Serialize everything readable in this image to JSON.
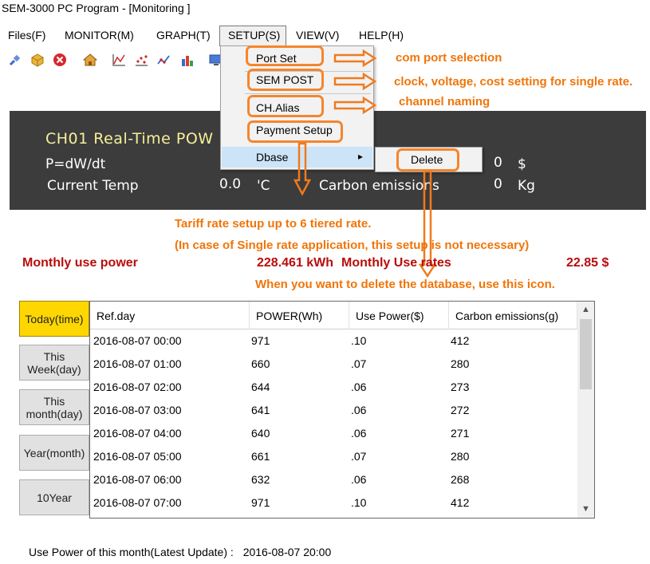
{
  "window": {
    "title": "SEM-3000 PC Program - [Monitoring ]"
  },
  "menu": {
    "items": [
      "Files(F)",
      "MONITOR(M)",
      "GRAPH(T)",
      "SETUP(S)",
      "VIEW(V)",
      "HELP(H)"
    ],
    "active": "SETUP(S)"
  },
  "toolbar": {
    "icons": [
      "plug-icon",
      "box-icon",
      "stop-icon",
      "home-icon",
      "chart-icon",
      "scatter-icon",
      "line-icon",
      "bar-chart-icon",
      "monitor-icon"
    ]
  },
  "setup_menu": {
    "items": [
      "Port Set",
      "SEM POST",
      "CH.Alias",
      "Payment Setup",
      "Dbase"
    ],
    "submenu_arrow": "▸",
    "submenu_items": [
      "Delete"
    ]
  },
  "realtime": {
    "title": "CH01   Real-Time POW",
    "formula": "P=dW/dt",
    "temp_label": "Current Temp",
    "temp_value": "0.0",
    "temp_unit": "'C",
    "carbon_label": "Carbon emissions",
    "rate_value": "0",
    "rate_unit": "$",
    "carbon_value": "0",
    "carbon_unit": "Kg"
  },
  "annotations": {
    "port_set": "com port selection",
    "sem_post": "clock, voltage, cost setting for single rate.",
    "alias": "channel naming",
    "payment_1": "Tariff rate setup up to 6 tiered rate.",
    "payment_2": "(In case of Single rate application, this setup is not necessary)",
    "delete": "When you want to delete the database, use this icon."
  },
  "monthly": {
    "use_power_label": "Monthly use power",
    "use_power_value": "228.461 kWh",
    "use_rates_label": "Monthly Use rates",
    "use_rates_value": "22.85 $"
  },
  "period_buttons": [
    "Today(time)",
    "This Week(day)",
    "This month(day)",
    "Year(month)",
    "10Year"
  ],
  "table": {
    "columns": [
      "Ref.day",
      "POWER(Wh)",
      "Use Power($)",
      "Carbon emissions(g)"
    ],
    "rows": [
      [
        "2016-08-07 00:00",
        "971",
        ".10",
        "412"
      ],
      [
        "2016-08-07 01:00",
        "660",
        ".07",
        "280"
      ],
      [
        "2016-08-07 02:00",
        "644",
        ".06",
        "273"
      ],
      [
        "2016-08-07 03:00",
        "641",
        ".06",
        "272"
      ],
      [
        "2016-08-07 04:00",
        "640",
        ".06",
        "271"
      ],
      [
        "2016-08-07 05:00",
        "661",
        ".07",
        "280"
      ],
      [
        "2016-08-07 06:00",
        "632",
        ".06",
        "268"
      ],
      [
        "2016-08-07 07:00",
        "971",
        ".10",
        "412"
      ]
    ]
  },
  "footer": {
    "label": "Use Power of this month(Latest Update) :",
    "value": "2016-08-07 20:00"
  },
  "colors": {
    "annotation": "#f0750a",
    "monthly_text": "#b80d0d",
    "panel_bg": "#3c3c3c",
    "panel_title": "#f6ef9a",
    "active_button": "#ffd700"
  }
}
